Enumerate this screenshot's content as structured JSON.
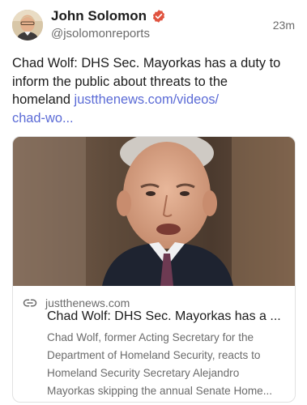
{
  "author": {
    "name": "John Solomon",
    "handle": "@jsolomonreports",
    "time": "23m",
    "avatar_icon": "avatar-photo",
    "verified_icon": "verified-badge-icon",
    "verified_color": "#e0533f"
  },
  "post": {
    "text_line1": "Chad Wolf: DHS Sec. Mayorkas has a duty to",
    "text_line2": "inform the public about threats to the",
    "text_line3": "homeland ",
    "link_line1": "justthenews.com/videos/",
    "link_line2": "chad-wo...",
    "link_color": "#5b6bd6"
  },
  "card": {
    "domain": "justthenews.com",
    "title": "Chad Wolf: DHS Sec. Mayorkas has a ...",
    "desc_line1": "Chad Wolf, former Acting Secretary for the",
    "desc_line2": "Department of Homeland Security, reacts to",
    "desc_line3": "Homeland Security Secretary Alejandro",
    "desc_line4": "Mayorkas skipping the annual Senate Home...",
    "link_icon": "link-chain-icon"
  }
}
